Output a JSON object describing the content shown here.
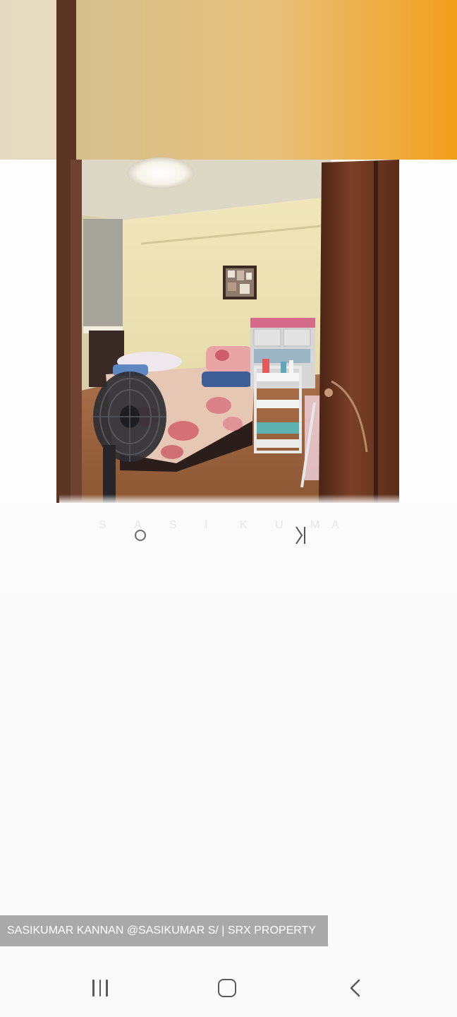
{
  "photo": {
    "description_icon": "bedroom-photo",
    "colors": {
      "ceiling_top": "#d9c493",
      "ceiling_accent": "#f0a12a",
      "wall": "#ede4b8",
      "floor": "#a06b45",
      "door": "#6a3a24",
      "bedsheet": "#e9c3b0"
    }
  },
  "watermark": {
    "letters": "SASIKUMAR"
  },
  "credit": {
    "text": "SASIKUMAR KANNAN @SASIKUMAR S/ | SRX PROPERTY"
  },
  "navbar": {
    "recent_icon": "recent-apps-icon",
    "home_icon": "home-icon",
    "back_icon": "back-icon"
  }
}
